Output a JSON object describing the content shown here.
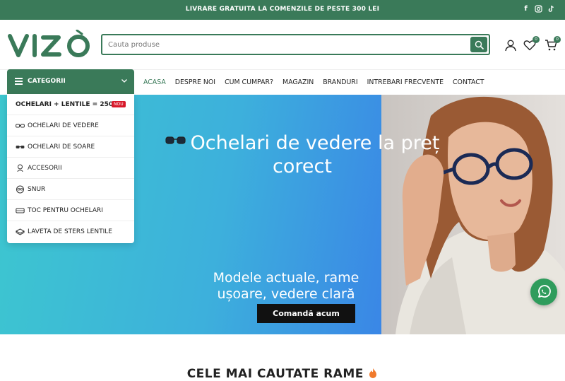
{
  "topbar": {
    "promo": "LIVRARE GRATUITA LA COMENZILE DE PESTE 300 LEI",
    "social": [
      "facebook-icon",
      "instagram-icon",
      "tiktok-icon"
    ],
    "color": "#3a7a59"
  },
  "header": {
    "logo_text": "VIZO",
    "search_placeholder": "Cauta produse",
    "wishlist_count": "0",
    "cart_count": "0"
  },
  "categories": {
    "label": "CATEGORII",
    "items": [
      {
        "label": "OCHELARI + LENTILE = 250 LEI",
        "badge": "NOU"
      },
      {
        "label": "OCHELARI DE VEDERE",
        "icon": "glasses-icon"
      },
      {
        "label": "OCHELARI DE SOARE",
        "icon": "sunglasses-icon"
      },
      {
        "label": "ACCESORII",
        "icon": "accessory-icon"
      },
      {
        "label": "SNUR",
        "icon": "cord-icon"
      },
      {
        "label": "TOC PENTRU OCHELARI",
        "icon": "case-icon"
      },
      {
        "label": "LAVETA DE STERS LENTILE",
        "icon": "cloth-icon"
      }
    ]
  },
  "nav": {
    "items": [
      "ACASA",
      "DESPRE NOI",
      "CUM CUMPAR?",
      "MAGAZIN",
      "BRANDURI",
      "INTREBARI FRECVENTE",
      "CONTACT"
    ],
    "active": "ACASA"
  },
  "hero": {
    "title": "Ochelari de vedere la preț corect",
    "subtitle": "Modele actuale, rame ușoare, vedere clară",
    "cta": "Comandă acum"
  },
  "section": {
    "title": "CELE MAI CAUTATE RAME"
  }
}
